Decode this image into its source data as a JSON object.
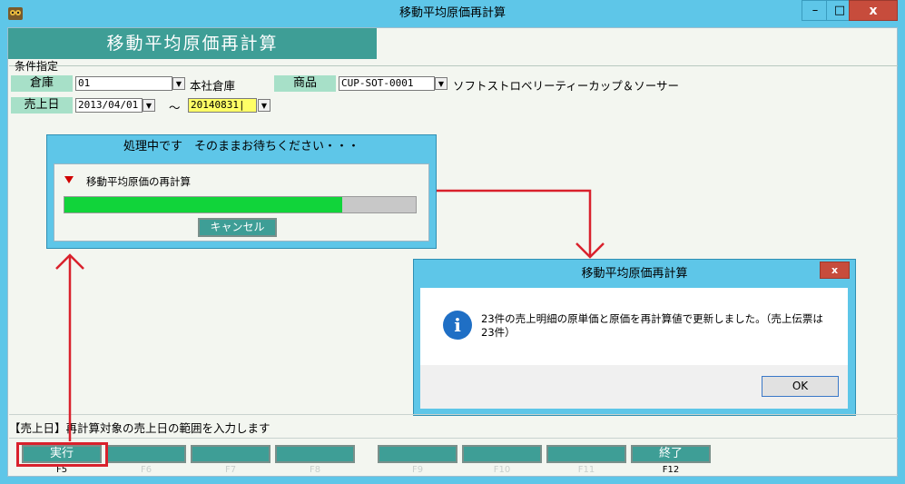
{
  "window": {
    "title": "移動平均原価再計算",
    "min": "–",
    "max": "□",
    "close": "x"
  },
  "header": {
    "title": "移動平均原価再計算"
  },
  "conditions": {
    "group_label": "条件指定",
    "warehouse": {
      "label": "倉庫",
      "code": "01",
      "name": "本社倉庫"
    },
    "product": {
      "label": "商品",
      "code": "CUP-SOT-0001",
      "name": "ソフトストロベリーティーカップ＆ソーサー"
    },
    "sales_date": {
      "label": "売上日",
      "from": "2013/04/01",
      "separator": "～",
      "to": "20140831|"
    }
  },
  "progress_dialog": {
    "title": "処理中です　そのままお待ちください・・・",
    "task": "移動平均原価の再計算",
    "progress_fraction": 0.79,
    "cancel_label": "キャンセル"
  },
  "message_dialog": {
    "title": "移動平均原価再計算",
    "close": "x",
    "line1": "23件の売上明細の原単価と原価を再計算値で更新しました。（売上伝票は",
    "line2": "23件）",
    "ok_label": "OK"
  },
  "hint": "【売上日】再計算対象の売上日の範囲を入力します",
  "function_keys": [
    {
      "label": "実行",
      "key": "F5"
    },
    {
      "label": "",
      "key": "F6"
    },
    {
      "label": "",
      "key": "F7"
    },
    {
      "label": "",
      "key": "F8"
    },
    {
      "label": "",
      "key": "F9"
    },
    {
      "label": "",
      "key": "F10"
    },
    {
      "label": "",
      "key": "F11"
    },
    {
      "label": "終了",
      "key": "F12"
    }
  ],
  "colors": {
    "window": "#5ec6e8",
    "teal": "#3e9e96",
    "progress": "#11d43a",
    "annotation": "#d9212c"
  }
}
